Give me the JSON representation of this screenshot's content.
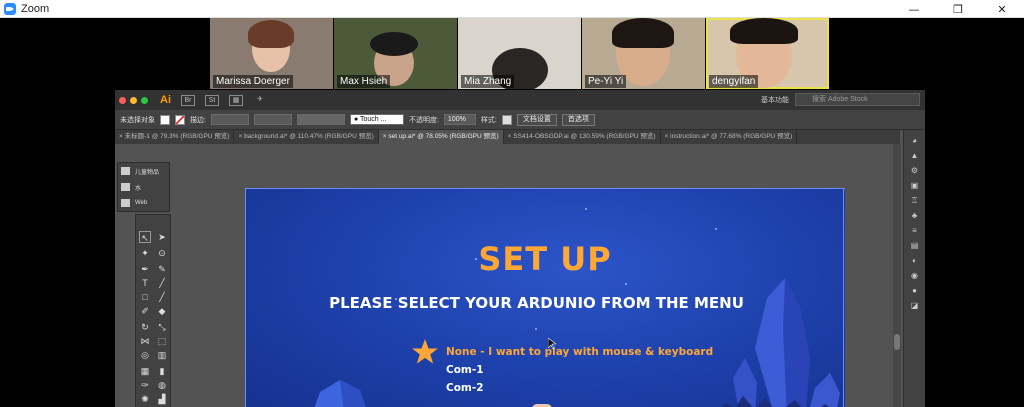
{
  "app": {
    "title": "Zoom"
  },
  "window_controls": {
    "minimize": "—",
    "restore": "❐",
    "close": "✕"
  },
  "participants": [
    {
      "name": "Marissa Doerger",
      "bg": "#8a7b70",
      "active": false
    },
    {
      "name": "Max Hsieh",
      "bg": "#4d5a3a",
      "active": false
    },
    {
      "name": "Mia Zhang",
      "bg": "#d9d4cc",
      "active": false
    },
    {
      "name": "Pe-Yi Yi",
      "bg": "#b8a992",
      "active": false
    },
    {
      "name": "dengyifan",
      "bg": "#d8c6ac",
      "active": true
    }
  ],
  "illustrator": {
    "logo": "Ai",
    "workspace": "基本功能",
    "stock_search_placeholder": "搜索 Adobe Stock",
    "control_bar": {
      "selection_label": "未选择对象",
      "stroke_label": "描边:",
      "brush_value": "Touch ...",
      "opacity_label": "不透明度:",
      "opacity_value": "100%",
      "style_label": "样式:",
      "doc_setup_button": "文档设置",
      "prefs_button": "首选项"
    },
    "tabs": [
      {
        "label": "未标题-1 @ 79.3% (RGB/GPU 预览)",
        "selected": false
      },
      {
        "label": "background.ai* @ 110.47% (RGB/GPU 预览)",
        "selected": false
      },
      {
        "label": "set up.ai* @ 78.05% (RGB/GPU 预览)",
        "selected": true
      },
      {
        "label": "SS414-OBSGDP.ai @ 130.59% (RGB/GPU 预览)",
        "selected": false
      },
      {
        "label": "instruction.ai* @ 77.68% (RGB/GPU 预览)",
        "selected": false
      }
    ],
    "layers": [
      {
        "label": "儿童物品"
      },
      {
        "label": "水"
      },
      {
        "label": "Web"
      }
    ]
  },
  "artboard": {
    "title": "SET UP",
    "subtitle": "PLEASE SELECT YOUR ARDUNIO FROM THE MENU",
    "options": [
      {
        "label": "None - I want to play with mouse & keyboard",
        "selected": true
      },
      {
        "label": "Com-1",
        "selected": false
      },
      {
        "label": "Com-2",
        "selected": false
      }
    ],
    "colors": {
      "accent": "#FFA735",
      "background": "#1c3fa8",
      "text": "#FFFFFF"
    }
  }
}
